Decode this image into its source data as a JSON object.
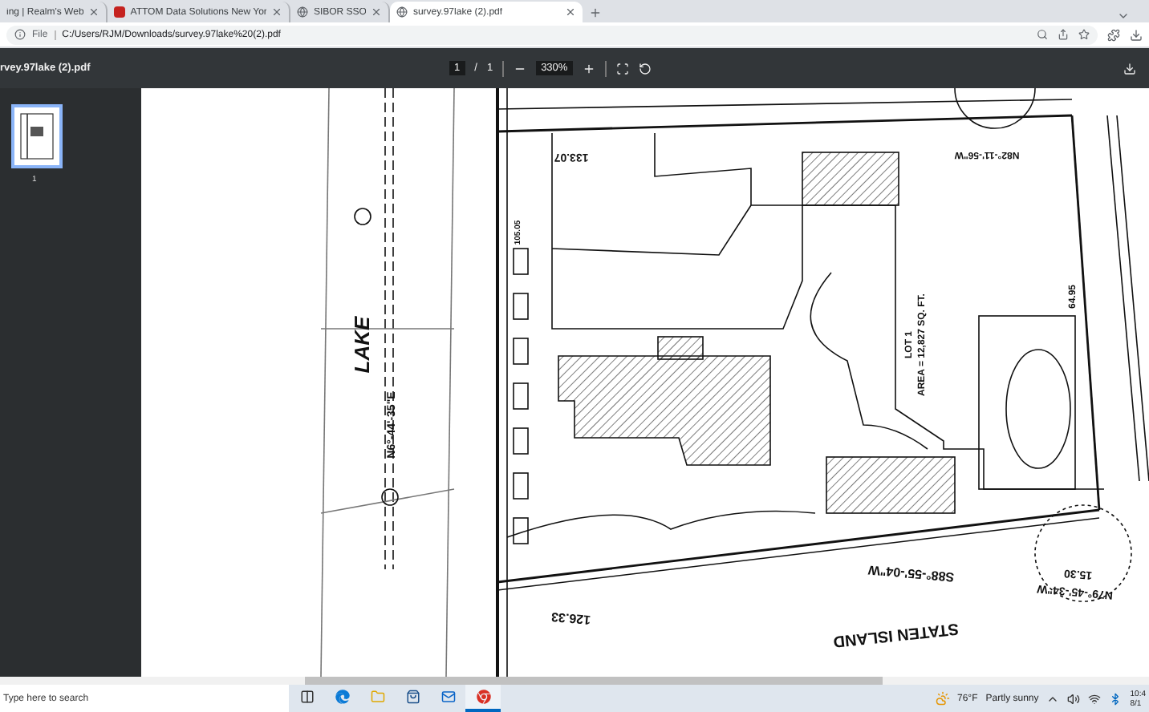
{
  "browser": {
    "tabs": [
      {
        "title": "ing | Realm's Web",
        "kind": "site",
        "selected": false
      },
      {
        "title": "ATTOM Data Solutions New Yor",
        "kind": "attom",
        "selected": false
      },
      {
        "title": "SIBOR SSO",
        "kind": "globe",
        "selected": false
      },
      {
        "title": "survey.97lake (2).pdf",
        "kind": "globe",
        "selected": true
      }
    ],
    "address": {
      "scheme": "File",
      "url": "C:/Users/RJM/Downloads/survey.97lake%20(2).pdf"
    }
  },
  "pdf_toolbar": {
    "file_name": "rvey.97lake (2).pdf",
    "page": "1",
    "page_separator": "/",
    "page_count": "1",
    "zoom": "330%"
  },
  "sidebar": {
    "thumbnails": [
      {
        "label": "1",
        "selected": true
      }
    ]
  },
  "survey": {
    "labels": [
      {
        "text": "LAKE"
      },
      {
        "text": "N6°-44'-35\"E"
      },
      {
        "text": "133.07"
      },
      {
        "text": "N82°-11'-56\"W"
      },
      {
        "text": "LOT 1"
      },
      {
        "text": "AREA = 12,827 SQ. FT."
      },
      {
        "text": "64.95"
      },
      {
        "text": "105.05"
      },
      {
        "text": "S88°-55'-04\"W"
      },
      {
        "text": "N79°-45'-34\"W"
      },
      {
        "text": "15.30"
      },
      {
        "text": "126.33"
      },
      {
        "text": "STATEN ISLAND"
      }
    ]
  },
  "taskbar": {
    "search_placeholder": "Type here to search",
    "apps": [
      {
        "kind": "task-view",
        "selected": false
      },
      {
        "kind": "edge",
        "selected": false
      },
      {
        "kind": "folder",
        "selected": false
      },
      {
        "kind": "store",
        "selected": false
      },
      {
        "kind": "mail",
        "selected": false
      },
      {
        "kind": "chrome",
        "selected": true
      }
    ],
    "weather_temp": "76°F",
    "weather_text": "Partly sunny",
    "time": "10:4",
    "date": "8/1"
  }
}
